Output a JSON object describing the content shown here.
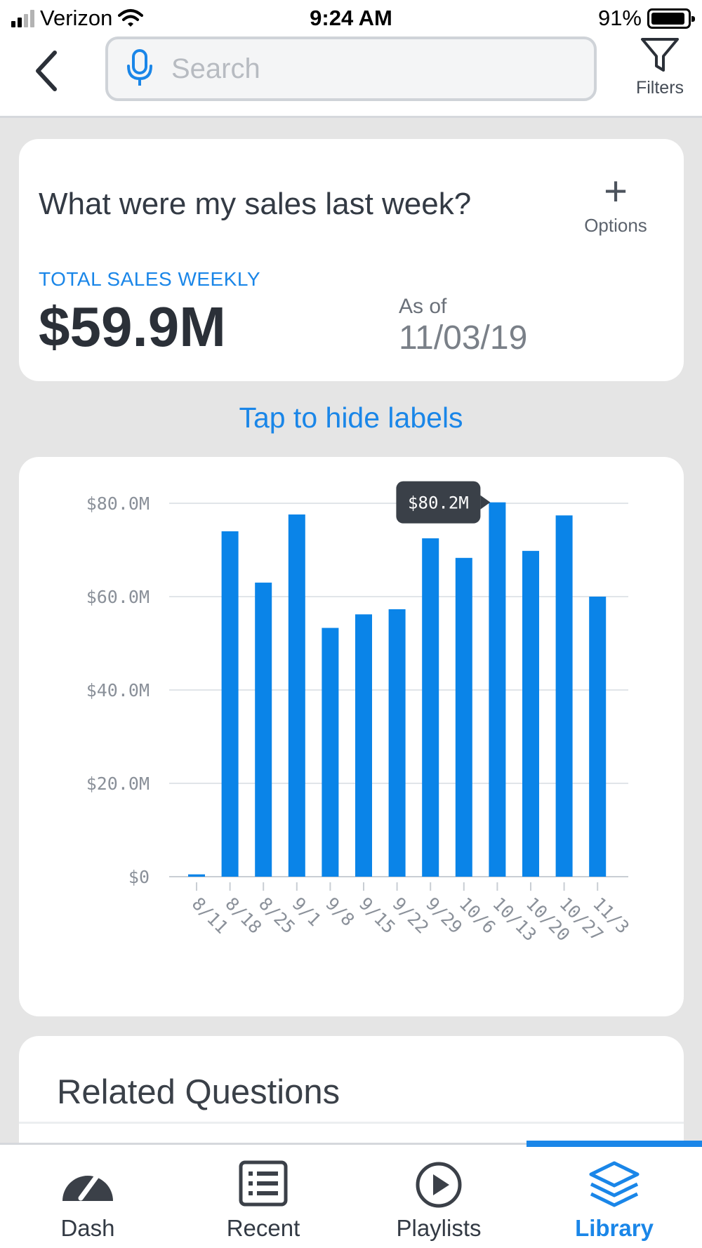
{
  "status_bar": {
    "carrier": "Verizon",
    "time": "9:24 AM",
    "battery": "91%"
  },
  "header": {
    "search_placeholder": "Search",
    "filters_label": "Filters"
  },
  "summary_card": {
    "question": "What were my sales last week?",
    "options_label": "Options",
    "kpi_label": "TOTAL SALES WEEKLY",
    "kpi_value": "$59.9M",
    "as_of_label": "As of",
    "as_of_date": "11/03/19"
  },
  "toggle_labels": "Tap to hide labels",
  "chart_data": {
    "type": "bar",
    "categories": [
      "8/11",
      "8/18",
      "8/25",
      "9/1",
      "9/8",
      "9/15",
      "9/22",
      "9/29",
      "10/6",
      "10/13",
      "10/20",
      "10/27",
      "11/3"
    ],
    "values": [
      0.5,
      74.0,
      63.0,
      77.6,
      53.3,
      56.2,
      57.3,
      72.5,
      68.3,
      80.2,
      69.8,
      77.4,
      60.0
    ],
    "y_ticks": [
      "$0",
      "$20.0M",
      "$40.0M",
      "$60.0M",
      "$80.0M"
    ],
    "y_tick_values": [
      0,
      20,
      40,
      60,
      80
    ],
    "ylim": [
      0,
      80
    ],
    "grid": true,
    "bar_color": "#0a84e8",
    "tooltip": {
      "category": "10/13",
      "text": "$80.2M"
    }
  },
  "related": {
    "title": "Related Questions"
  },
  "tabbar": {
    "items": [
      {
        "label": "Dash",
        "icon": "gauge-icon",
        "active": false
      },
      {
        "label": "Recent",
        "icon": "list-icon",
        "active": false
      },
      {
        "label": "Playlists",
        "icon": "play-circle-icon",
        "active": false
      },
      {
        "label": "Library",
        "icon": "layers-icon",
        "active": true
      }
    ]
  },
  "colors": {
    "accent": "#1a86e8",
    "background": "#e5e5e5",
    "text": "#333a44"
  }
}
